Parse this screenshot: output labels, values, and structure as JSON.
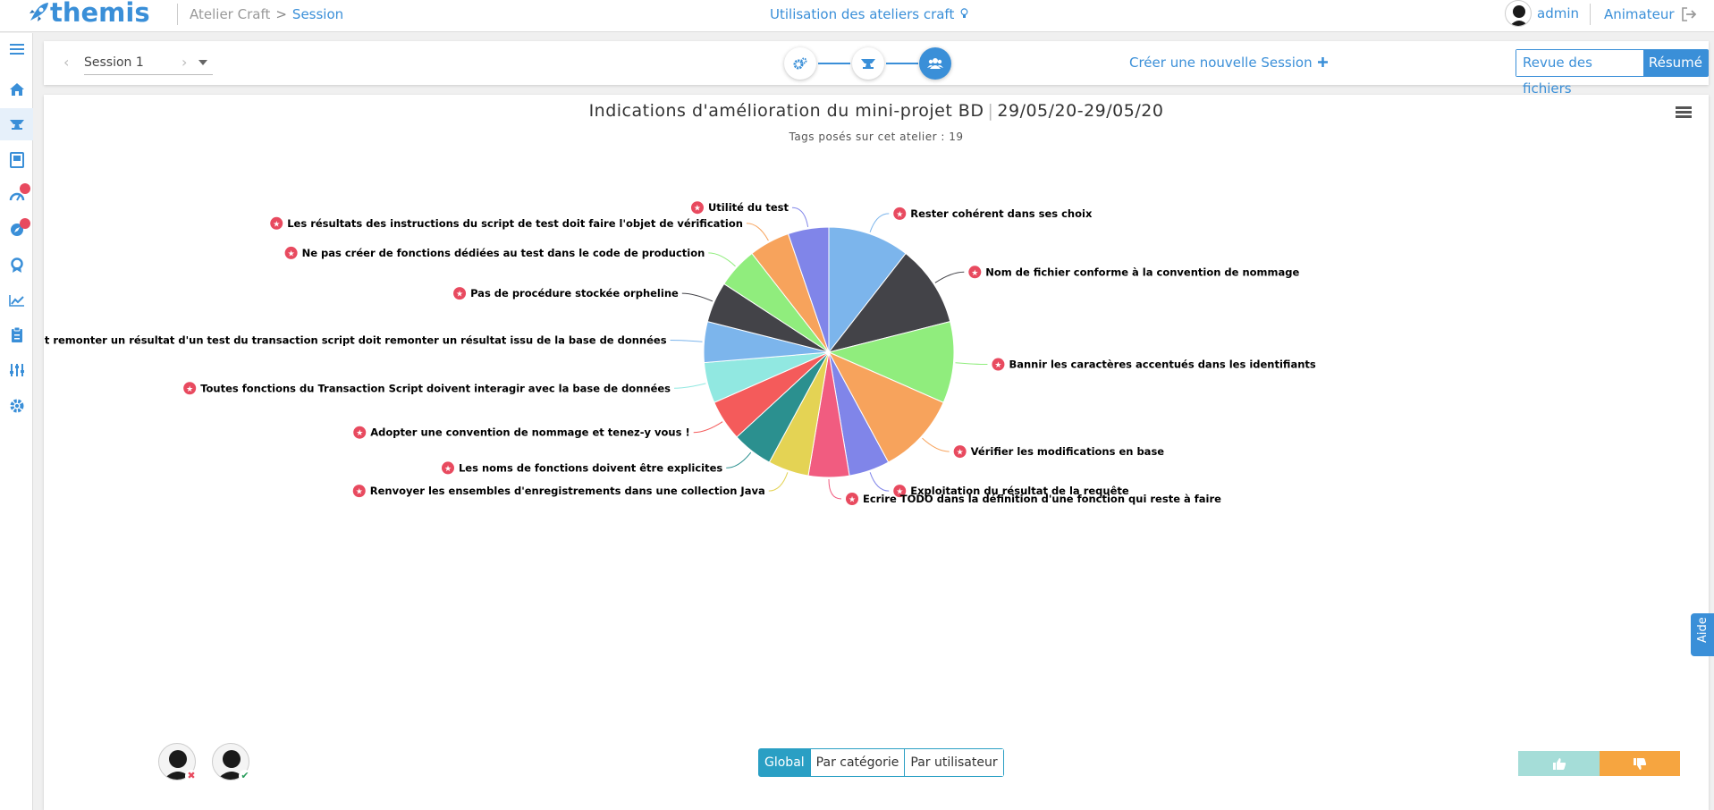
{
  "header": {
    "logo_text": "themis",
    "breadcrumb": {
      "root": "Atelier Craft",
      "separator": ">",
      "current": "Session"
    },
    "center_title": "Utilisation des ateliers craft",
    "user_name": "admin",
    "role": "Animateur"
  },
  "sidebar": {
    "items": [
      {
        "icon": "menu-icon"
      },
      {
        "icon": "home-icon"
      },
      {
        "icon": "anvil-icon",
        "active": true
      },
      {
        "icon": "book-icon"
      },
      {
        "icon": "gauge-icon",
        "badge": true
      },
      {
        "icon": "compass-icon",
        "badge": true
      },
      {
        "icon": "award-icon"
      },
      {
        "icon": "chart-line-icon"
      },
      {
        "icon": "clipboard-icon"
      },
      {
        "icon": "sliders-icon"
      },
      {
        "icon": "gear-icon"
      }
    ]
  },
  "toolbar": {
    "session_label": "Session 1",
    "new_session_label": "Créer une nouvelle Session",
    "review_files_label": "Revue des fichiers",
    "summary_label": "Résumé"
  },
  "chart_data": {
    "type": "pie",
    "title": "Indications d'amélioration du mini-projet BD",
    "date_range": "29/05/20-29/05/20",
    "subtitle": "Tags posés sur cet atelier : 19",
    "slices": [
      {
        "label": "Rester cohérent dans ses choix",
        "value": 1,
        "color": "#7cb5ec"
      },
      {
        "label": "Nom de fichier conforme à la convention de nommage",
        "value": 1,
        "color": "#434348"
      },
      {
        "label": "Bannir les caractères accentués dans les identifiants",
        "value": 1,
        "color": "#90ed7d"
      },
      {
        "label": "Vérifier les modifications en base",
        "value": 1,
        "color": "#f7a35c"
      },
      {
        "label": "Exploitation du résultat de la requête",
        "value": 0.5,
        "color": "#8085e9"
      },
      {
        "label": "Ecrire TODO dans la définition d'une fonction qui reste à faire",
        "value": 0.5,
        "color": "#f15c80"
      },
      {
        "label": "Renvoyer les ensembles d'enregistrements dans une collection Java",
        "value": 0.5,
        "color": "#e4d354"
      },
      {
        "label": "Les noms de fonctions doivent être explicites",
        "value": 0.5,
        "color": "#2b908f"
      },
      {
        "label": "Adopter une convention de nommage et tenez-y vous !",
        "value": 0.5,
        "color": "#f45b5b"
      },
      {
        "label": "Toutes fonctions du Transaction Script doivent interagir avec la base de données",
        "value": 0.5,
        "color": "#91e8e1"
      },
      {
        "label": "Toutes fonctions du Transaction Script doit remonter un résultat d'un test du transaction script doit remonter un résultat issu de la base de données",
        "value": 0.5,
        "color": "#7cb5ec"
      },
      {
        "label": "Pas de procédure stockée orpheline",
        "value": 0.5,
        "color": "#434348"
      },
      {
        "label": "Ne pas créer de fonctions dédiées au test dans le code de production",
        "value": 0.5,
        "color": "#90ed7d"
      },
      {
        "label": "Les résultats des instructions du script de test doit faire l'objet de vérification",
        "value": 0.5,
        "color": "#f7a35c"
      },
      {
        "label": "Utilité du test",
        "value": 0.5,
        "color": "#8085e9"
      }
    ]
  },
  "view_toggle": {
    "global": "Global",
    "by_category": "Par catégorie",
    "by_user": "Par utilisateur"
  },
  "help_label": "Aide",
  "colors": {
    "accent": "#3a8fd8",
    "toggle": "#2a9fc4",
    "like": "#a5ddd8",
    "dislike": "#f6a540",
    "badge": "#e84a5f"
  }
}
